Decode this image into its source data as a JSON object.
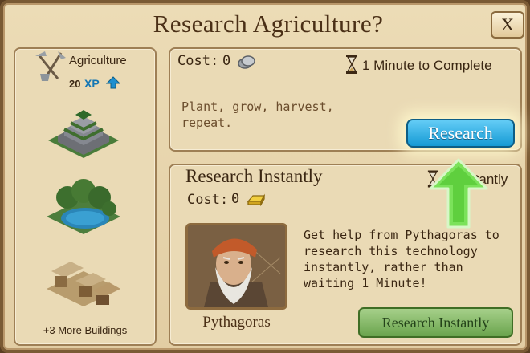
{
  "dialog": {
    "title": "Research Agriculture?",
    "close_label": "X"
  },
  "tech": {
    "name": "Agriculture",
    "xp_value": "20",
    "xp_label": "XP",
    "more_buildings": "+3 More Buildings"
  },
  "research": {
    "cost_label": "Cost:",
    "cost_value": "0",
    "time_label": "1 Minute to Complete",
    "description": "Plant, grow, harvest, repeat.",
    "button_label": "Research"
  },
  "instant": {
    "heading": "Research Instantly",
    "cost_label": "Cost:",
    "cost_value": "0",
    "description": "Get help from Pythagoras to research this technology instantly, rather than waiting 1 Minute!",
    "advisor_name": "Pythagoras",
    "button_label": "Research Instantly",
    "obscured_label": "Instantly"
  },
  "colors": {
    "research_button": "#1aa0d8",
    "instant_button": "#7bb35d",
    "arrow": "#7be25a",
    "title": "#4a2f16"
  }
}
